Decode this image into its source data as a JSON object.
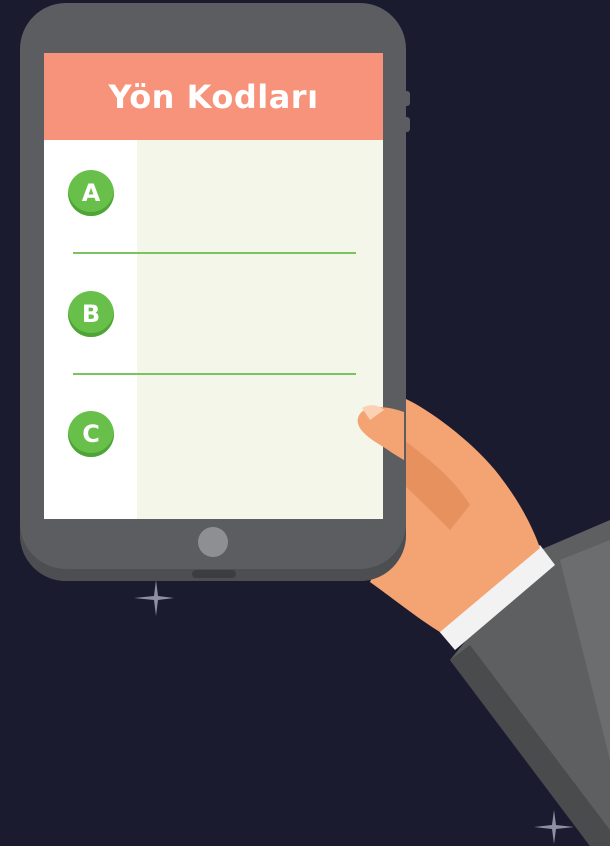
{
  "screen": {
    "title": "Yön Kodları",
    "options": [
      {
        "letter": "A",
        "text": ""
      },
      {
        "letter": "B",
        "text": ""
      },
      {
        "letter": "C",
        "text": ""
      }
    ]
  },
  "colors": {
    "background": "#1b1b2f",
    "header": "#f7937a",
    "badge": "#68c04a",
    "tablet_body": "#5c5d60",
    "screen_bg": "#f3f6e9"
  },
  "icons": [
    "sparkle-icon",
    "home-button",
    "hand-illustration"
  ]
}
